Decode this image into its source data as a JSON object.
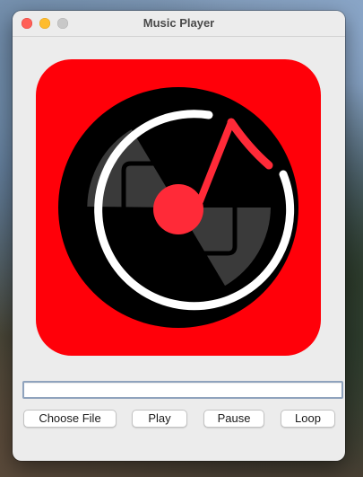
{
  "window": {
    "title": "Music Player",
    "controls": [
      "close",
      "minimize",
      "zoom"
    ]
  },
  "artwork": {
    "icon": "music-disc-icon",
    "background_color": "#ff0009",
    "disc_color": "#000000",
    "ring_color": "#ffffff",
    "note_color": "#ff2a38",
    "segment_color": "#3a3a3a"
  },
  "file_field": {
    "value": "",
    "placeholder": ""
  },
  "buttons": {
    "choose_file": "Choose File",
    "play": "Play",
    "pause": "Pause",
    "loop": "Loop"
  }
}
